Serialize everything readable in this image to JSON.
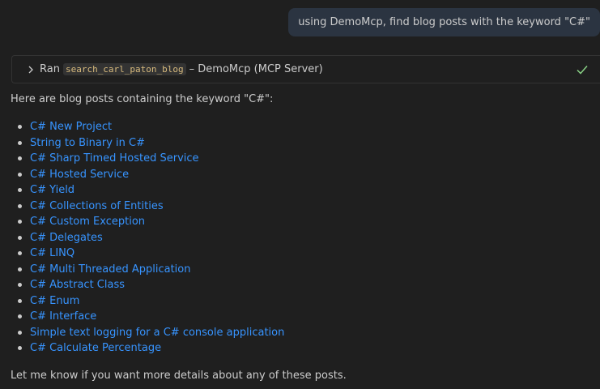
{
  "user_message": "using DemoMcp, find blog posts with the keyword \"C#\"",
  "tool_call": {
    "prefix": "Ran",
    "tool_name": "search_carl_paton_blog",
    "suffix": "– DemoMcp (MCP Server)",
    "status_icon": "checkmark-icon",
    "status_color": "#89d185"
  },
  "response": {
    "intro": "Here are blog posts containing the keyword \"C#\":",
    "posts": [
      "C# New Project",
      "String to Binary in C#",
      "C# Sharp Timed Hosted Service",
      "C# Hosted Service",
      "C# Yield",
      "C# Collections of Entities",
      "C# Custom Exception",
      "C# Delegates",
      "C# LINQ",
      "C# Multi Threaded Application",
      "C# Abstract Class",
      "C# Enum",
      "C# Interface",
      "Simple text logging for a C# console application",
      "C# Calculate Percentage"
    ],
    "outro": "Let me know if you want more details about any of these posts."
  },
  "colors": {
    "background": "#1f1f1f",
    "link": "#3794ff",
    "user_bubble": "#2b3441"
  }
}
